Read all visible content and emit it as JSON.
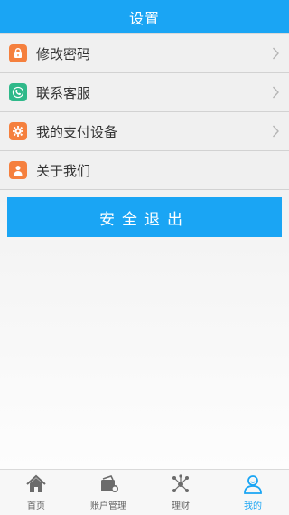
{
  "header": {
    "title": "设置"
  },
  "menu": {
    "items": [
      {
        "label": "修改密码",
        "icon": "lock-icon",
        "has_arrow": true
      },
      {
        "label": "联系客服",
        "icon": "phone-icon",
        "has_arrow": true
      },
      {
        "label": "我的支付设备",
        "icon": "device-gear-icon",
        "has_arrow": true
      },
      {
        "label": "关于我们",
        "icon": "user-icon",
        "has_arrow": false
      }
    ]
  },
  "logout": {
    "label": "安全退出"
  },
  "tabbar": {
    "tabs": [
      {
        "label": "首页",
        "icon": "home-icon",
        "active": false
      },
      {
        "label": "账户管理",
        "icon": "wallet-icon",
        "active": false
      },
      {
        "label": "理财",
        "icon": "network-icon",
        "active": false
      },
      {
        "label": "我的",
        "icon": "profile-icon",
        "active": true
      }
    ]
  },
  "colors": {
    "primary": "#1aa5f4",
    "icon_orange": "#f5803e",
    "icon_green": "#2fb98a",
    "tab_inactive": "#666666"
  }
}
